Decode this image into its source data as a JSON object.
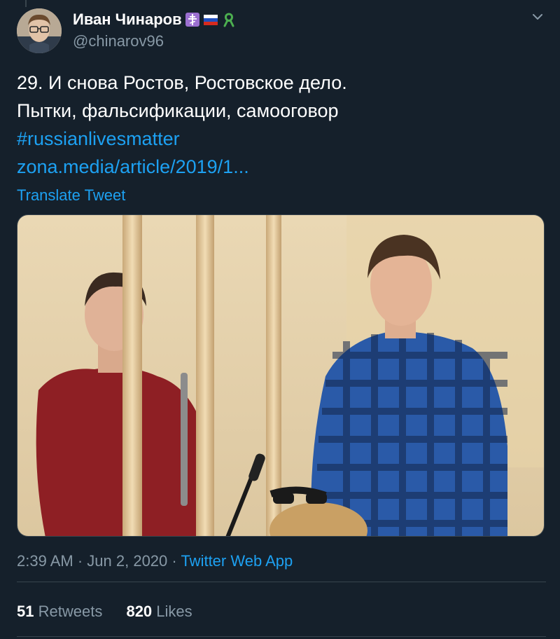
{
  "tweet": {
    "author": {
      "display_name": "Иван Чинаров",
      "handle": "@chinarov96",
      "badges": [
        "orthodox-cross-icon",
        "russian-flag-icon",
        "ribbon-icon"
      ]
    },
    "text": {
      "line1": "29. И снова Ростов, Ростовское дело.",
      "line2": "Пытки, фальсификации, самооговор",
      "hashtag": "#russianlivesmatter",
      "link": "zona.media/article/2019/1..."
    },
    "translate_label": "Translate Tweet",
    "meta": {
      "time": "2:39 AM",
      "separator": "·",
      "date": "Jun 2, 2020",
      "source": "Twitter Web App"
    },
    "stats": {
      "retweets_count": "51",
      "retweets_label": "Retweets",
      "likes_count": "820",
      "likes_label": "Likes"
    },
    "colors": {
      "background": "#15202b",
      "accent": "#1da1f2",
      "secondary_text": "#8899a6",
      "border": "#38444d"
    }
  }
}
